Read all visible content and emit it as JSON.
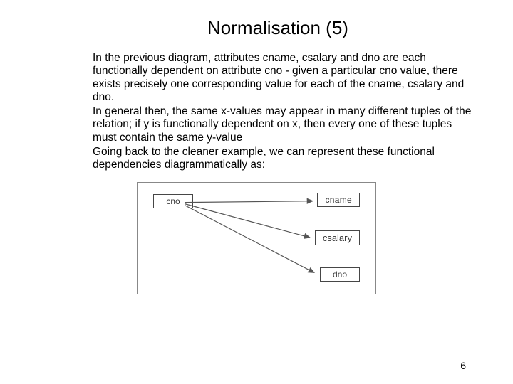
{
  "title": "Normalisation (5)",
  "paragraphs": {
    "p1": "In the previous diagram, attributes cname, csalary and dno are each functionally dependent on attribute cno - given a particular cno value, there exists precisely one corresponding value for each of the cname, csalary and dno.",
    "p2": "In general then, the same x-values may appear in many different tuples of the relation; if y is functionally dependent on x, then every one of these tuples must contain the same y-value",
    "p3": "Going back to the cleaner example, we can represent these functional dependencies diagrammatically as:"
  },
  "diagram": {
    "source": "cno",
    "targets": {
      "a": "cname",
      "b": "csalary",
      "c": "dno"
    }
  },
  "page_number": "6"
}
